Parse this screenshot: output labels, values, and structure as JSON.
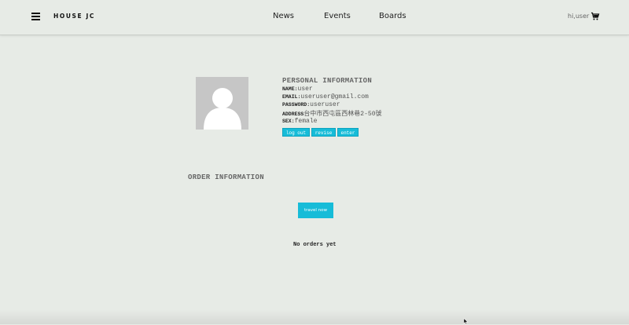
{
  "header": {
    "brand": "HOUSE JC",
    "nav": [
      "News",
      "Events",
      "Boards"
    ],
    "greeting": "hi,user",
    "menu_icon": "hamburger-icon",
    "cart_icon": "cart-icon"
  },
  "profile": {
    "title": "PERSONAL INFORMATION",
    "fields": [
      {
        "label": "NAME:",
        "value": "user"
      },
      {
        "label": "EMAIL:",
        "value": "useruser@gmail.com"
      },
      {
        "label": "PASSWORD:",
        "value": "useruser"
      },
      {
        "label": "ADDRESS",
        "value": "台中市西屯區西林巷2-50號"
      },
      {
        "label": "SEX:",
        "value": "female"
      }
    ],
    "buttons": [
      "log out",
      "revise",
      "enter"
    ],
    "avatar_icon": "user-avatar-icon"
  },
  "orders": {
    "title": "ORDER INFORMATION",
    "travel_button": "travel now",
    "empty_text": "No orders yet"
  },
  "colors": {
    "background": "#e7ebe6",
    "accent": "#17bcd8"
  }
}
